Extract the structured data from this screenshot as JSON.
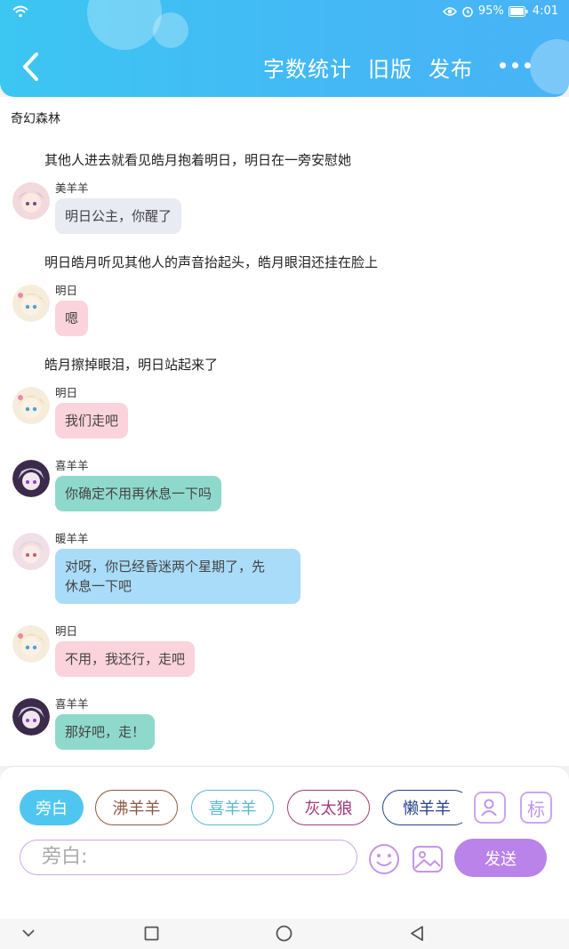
{
  "status": {
    "battery": "95%",
    "time": "4:01"
  },
  "header": {
    "actions": [
      "字数统计",
      "旧版",
      "发布"
    ]
  },
  "story": {
    "title": "奇幻森林",
    "entries": [
      {
        "type": "narration",
        "text": "其他人进去就看见皓月抱着明日，明日在一旁安慰她"
      },
      {
        "type": "message",
        "speaker": "美羊羊",
        "text": "明日公主，你醒了",
        "color": "#e8ebf1"
      },
      {
        "type": "narration",
        "text": "明日皓月听见其他人的声音抬起头，皓月眼泪还挂在脸上"
      },
      {
        "type": "message",
        "speaker": "明日",
        "text": "嗯",
        "color": "#fbd3dc"
      },
      {
        "type": "narration",
        "text": "皓月擦掉眼泪，明日站起来了"
      },
      {
        "type": "message",
        "speaker": "明日",
        "text": "我们走吧",
        "color": "#fbd3dc"
      },
      {
        "type": "message",
        "speaker": "喜羊羊",
        "text": "你确定不用再休息一下吗",
        "color": "#8fd9cc"
      },
      {
        "type": "message",
        "speaker": "暖羊羊",
        "text_lines": [
          "对呀，你已经昏迷两个星期了，先",
          "休息一下吧"
        ],
        "color": "#a9dcf9"
      },
      {
        "type": "message",
        "speaker": "明日",
        "text": "不用，我还行，走吧",
        "color": "#fbd3dc"
      },
      {
        "type": "message",
        "speaker": "喜羊羊",
        "text": "那好吧，走！",
        "color": "#8fd9cc"
      }
    ]
  },
  "composer": {
    "chips": [
      {
        "label": "旁白",
        "color": "#4fc6f0",
        "active": true
      },
      {
        "label": "沸羊羊",
        "color": "#8a5a44"
      },
      {
        "label": "喜羊羊",
        "color": "#5bb8cf"
      },
      {
        "label": "灰太狼",
        "color": "#a23b7c"
      },
      {
        "label": "懒羊羊",
        "color": "#27438e"
      }
    ],
    "mark_label": "标",
    "input_placeholder": "旁白:",
    "send_label": "发送"
  }
}
